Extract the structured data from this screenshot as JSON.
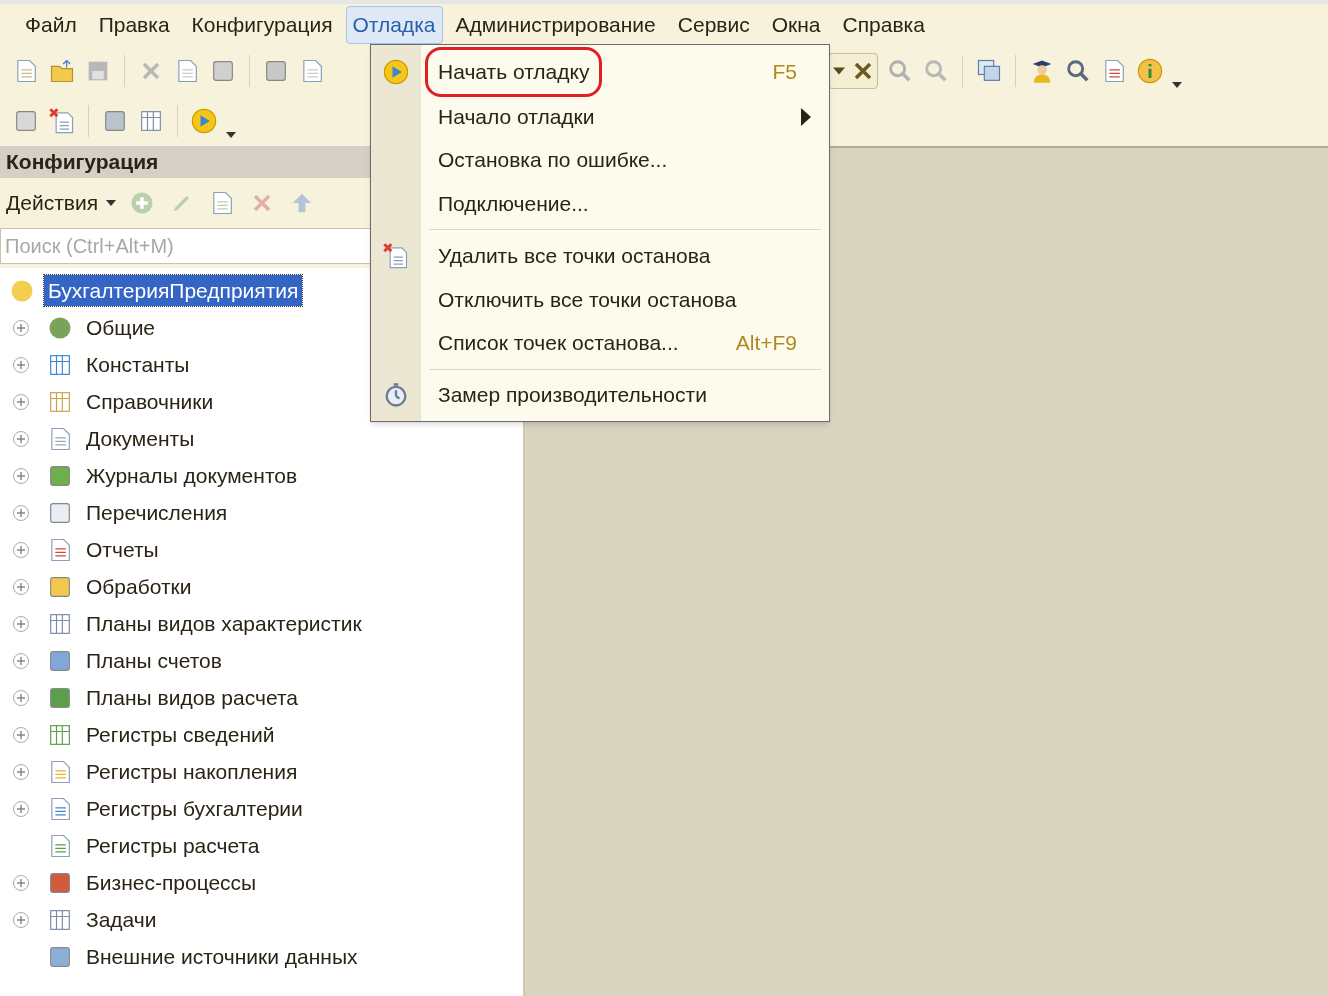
{
  "menu_bar": [
    {
      "label": "Файл",
      "selected": false
    },
    {
      "label": "Правка",
      "selected": false
    },
    {
      "label": "Конфигурация",
      "selected": false
    },
    {
      "label": "Отладка",
      "selected": true
    },
    {
      "label": "Администрирование",
      "selected": false
    },
    {
      "label": "Сервис",
      "selected": false
    },
    {
      "label": "Окна",
      "selected": false
    },
    {
      "label": "Справка",
      "selected": false
    }
  ],
  "debug_menu": [
    {
      "kind": "item",
      "label": "Начать отладку",
      "shortcut": "F5",
      "submenu": false,
      "highlighted": true
    },
    {
      "kind": "item",
      "label": "Начало отладки",
      "submenu": true,
      "highlighted": false
    },
    {
      "kind": "item",
      "label": "Остановка по ошибке...",
      "submenu": false,
      "highlighted": false
    },
    {
      "kind": "item",
      "label": "Подключение...",
      "submenu": false,
      "highlighted": false
    },
    {
      "kind": "separator"
    },
    {
      "kind": "item",
      "label": "Удалить все точки останова",
      "submenu": false,
      "highlighted": false
    },
    {
      "kind": "item",
      "label": "Отключить все точки останова",
      "submenu": false,
      "highlighted": false
    },
    {
      "kind": "item",
      "label": "Список точек останова...",
      "shortcut": "Alt+F9",
      "submenu": false,
      "highlighted": false
    },
    {
      "kind": "separator"
    },
    {
      "kind": "item",
      "label": "Замер производительности",
      "submenu": false,
      "highlighted": false
    }
  ],
  "config_panel": {
    "title": "Конфигурация",
    "actions_label": "Действия",
    "search": {
      "placeholder": "Поиск (Ctrl+Alt+M)"
    },
    "tree": {
      "label": "БухгалтерияПредприятия",
      "selected": true,
      "children": [
        {
          "label": "Общие",
          "expandable": true
        },
        {
          "label": "Константы",
          "expandable": true
        },
        {
          "label": "Справочники",
          "expandable": true
        },
        {
          "label": "Документы",
          "expandable": true
        },
        {
          "label": "Журналы документов",
          "expandable": true
        },
        {
          "label": "Перечисления",
          "expandable": true
        },
        {
          "label": "Отчеты",
          "expandable": true
        },
        {
          "label": "Обработки",
          "expandable": true
        },
        {
          "label": "Планы видов характеристик",
          "expandable": true
        },
        {
          "label": "Планы счетов",
          "expandable": true
        },
        {
          "label": "Планы видов расчета",
          "expandable": true
        },
        {
          "label": "Регистры сведений",
          "expandable": true
        },
        {
          "label": "Регистры накопления",
          "expandable": true
        },
        {
          "label": "Регистры бухгалтерии",
          "expandable": true
        },
        {
          "label": "Регистры расчета",
          "expandable": false
        },
        {
          "label": "Бизнес-процессы",
          "expandable": true
        },
        {
          "label": "Задачи",
          "expandable": true
        },
        {
          "label": "Внешние источники данных",
          "expandable": false
        }
      ]
    }
  }
}
